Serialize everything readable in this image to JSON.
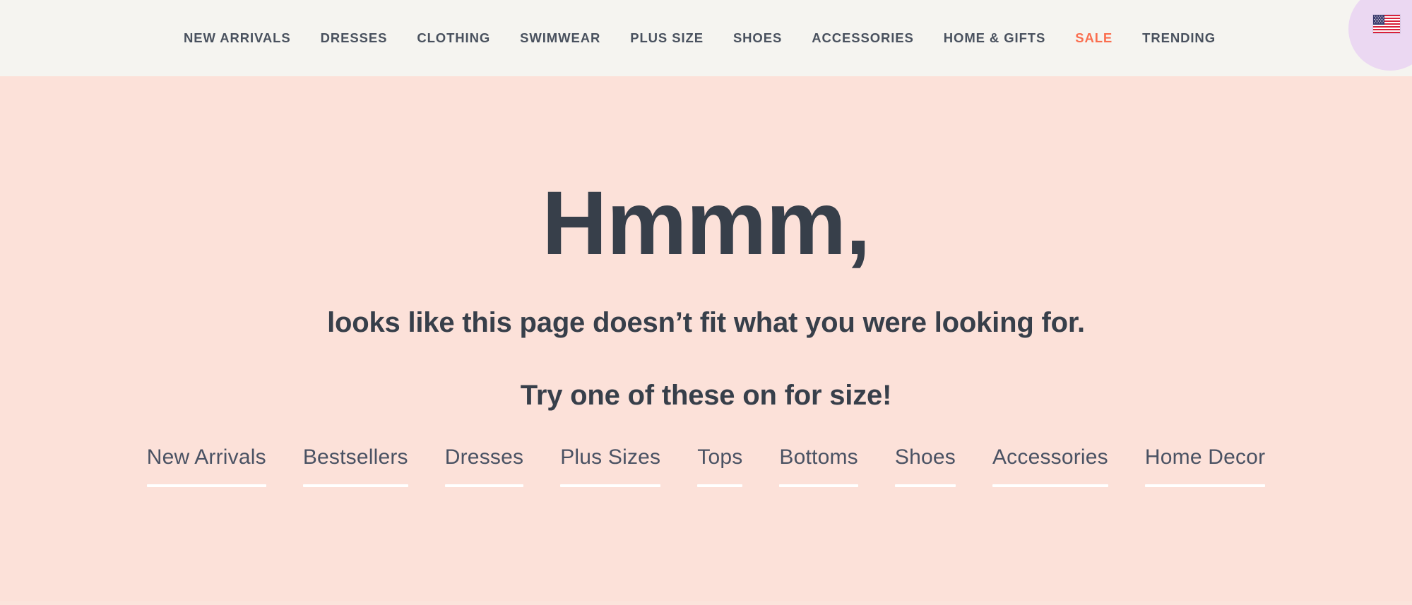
{
  "header": {
    "background_color": "#F5F4F0",
    "nav": [
      {
        "label": "NEW ARRIVALS",
        "highlight": false
      },
      {
        "label": "DRESSES",
        "highlight": false
      },
      {
        "label": "CLOTHING",
        "highlight": false
      },
      {
        "label": "SWIMWEAR",
        "highlight": false
      },
      {
        "label": "PLUS SIZE",
        "highlight": false
      },
      {
        "label": "SHOES",
        "highlight": false
      },
      {
        "label": "ACCESSORIES",
        "highlight": false
      },
      {
        "label": "HOME & GIFTS",
        "highlight": false
      },
      {
        "label": "SALE",
        "highlight": true
      },
      {
        "label": "TRENDING",
        "highlight": false
      }
    ],
    "nav_text_color": "#49515E",
    "sale_color": "#FA6E4F",
    "locale_badge": {
      "icon": "us-flag-icon",
      "badge_color": "#EBD8F2"
    }
  },
  "main": {
    "background_color": "#FCE1D9",
    "text_color": "#373F4A",
    "headline": "Hmmm,",
    "subline": "looks like this page doesn’t fit what you were looking for.",
    "prompt": "Try one of these on for size!",
    "quick_links": [
      {
        "label": "New Arrivals"
      },
      {
        "label": "Bestsellers"
      },
      {
        "label": "Dresses"
      },
      {
        "label": "Plus Sizes"
      },
      {
        "label": "Tops"
      },
      {
        "label": "Bottoms"
      },
      {
        "label": "Shoes"
      },
      {
        "label": "Accessories"
      },
      {
        "label": "Home Decor"
      }
    ],
    "quick_link_color": "#4A5263",
    "quick_link_underline_color": "#FFFFFF"
  }
}
